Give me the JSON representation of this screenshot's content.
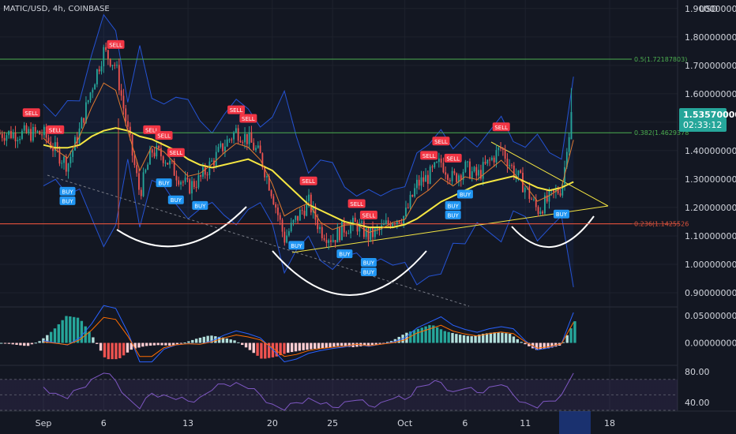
{
  "header": {
    "symbol_line": "MATIC/USD, 4h, COINBASE",
    "currency": "USD"
  },
  "price_axis": {
    "labels": [
      "1.90000000",
      "1.80000000",
      "1.70000000",
      "1.60000000",
      "1.40000000",
      "1.30000000",
      "1.20000000",
      "1.10000000",
      "1.00000000",
      "0.90000000"
    ],
    "current_price": "1.53570000",
    "countdown": "02:33:12"
  },
  "fib_levels": [
    {
      "label": "0.5(1.72187803)",
      "value": 1.72187803,
      "color": "#4caf50"
    },
    {
      "label": "0.382(1.4629378",
      "value": 1.4629378,
      "color": "#4caf50"
    },
    {
      "label": "0.236(1.1425526",
      "value": 1.1425526,
      "color": "#e0533c"
    }
  ],
  "time_axis": {
    "labels": [
      "Sep",
      "6",
      "13",
      "20",
      "25",
      "Oct",
      "6",
      "11",
      "18"
    ]
  },
  "macd_axis": {
    "labels": [
      "0.05000000",
      "0.00000000"
    ]
  },
  "rsi_axis": {
    "labels": [
      "80.00",
      "40.00"
    ]
  },
  "signal_labels": {
    "buy": "BUY",
    "sell": "SELL"
  },
  "colors": {
    "background": "#131722",
    "up_candle": "#26a69a",
    "down_candle": "#ef5350",
    "sma": "#f5e642",
    "bollinger": "#2962ff",
    "rsi": "#7e57c2",
    "buy_badge": "#2196f3",
    "sell_badge": "#f23645",
    "current_price_badge": "#26a69a"
  },
  "chart_data": {
    "type": "candlestick",
    "symbol": "MATIC/USD",
    "timeframe": "4h",
    "exchange": "COINBASE",
    "ylim": [
      0.85,
      1.93
    ],
    "current_price": 1.5357,
    "close_path": [
      {
        "date": "2021-09-01",
        "close": 1.46
      },
      {
        "date": "2021-09-02",
        "close": 1.4
      },
      {
        "date": "2021-09-03",
        "close": 1.35
      },
      {
        "date": "2021-09-04",
        "close": 1.47
      },
      {
        "date": "2021-09-05",
        "close": 1.62
      },
      {
        "date": "2021-09-06",
        "close": 1.75
      },
      {
        "date": "2021-09-07",
        "close": 1.7
      },
      {
        "date": "2021-09-08",
        "close": 1.47
      },
      {
        "date": "2021-09-09",
        "close": 1.25
      },
      {
        "date": "2021-09-10",
        "close": 1.4
      },
      {
        "date": "2021-09-11",
        "close": 1.38
      },
      {
        "date": "2021-09-12",
        "close": 1.32
      },
      {
        "date": "2021-09-13",
        "close": 1.27
      },
      {
        "date": "2021-09-14",
        "close": 1.3
      },
      {
        "date": "2021-09-15",
        "close": 1.36
      },
      {
        "date": "2021-09-16",
        "close": 1.42
      },
      {
        "date": "2021-09-17",
        "close": 1.47
      },
      {
        "date": "2021-09-18",
        "close": 1.44
      },
      {
        "date": "2021-09-19",
        "close": 1.38
      },
      {
        "date": "2021-09-20",
        "close": 1.25
      },
      {
        "date": "2021-09-21",
        "close": 1.09
      },
      {
        "date": "2021-09-22",
        "close": 1.16
      },
      {
        "date": "2021-09-23",
        "close": 1.22
      },
      {
        "date": "2021-09-24",
        "close": 1.12
      },
      {
        "date": "2021-09-25",
        "close": 1.09
      },
      {
        "date": "2021-09-26",
        "close": 1.13
      },
      {
        "date": "2021-09-27",
        "close": 1.14
      },
      {
        "date": "2021-09-28",
        "close": 1.1
      },
      {
        "date": "2021-09-29",
        "close": 1.12
      },
      {
        "date": "2021-09-30",
        "close": 1.16
      },
      {
        "date": "2021-10-01",
        "close": 1.17
      },
      {
        "date": "2021-10-02",
        "close": 1.28
      },
      {
        "date": "2021-10-03",
        "close": 1.31
      },
      {
        "date": "2021-10-04",
        "close": 1.36
      },
      {
        "date": "2021-10-05",
        "close": 1.3
      },
      {
        "date": "2021-10-06",
        "close": 1.34
      },
      {
        "date": "2021-10-07",
        "close": 1.31
      },
      {
        "date": "2021-10-08",
        "close": 1.36
      },
      {
        "date": "2021-10-09",
        "close": 1.41
      },
      {
        "date": "2021-10-10",
        "close": 1.33
      },
      {
        "date": "2021-10-11",
        "close": 1.27
      },
      {
        "date": "2021-10-12",
        "close": 1.19
      },
      {
        "date": "2021-10-13",
        "close": 1.23
      },
      {
        "date": "2021-10-14",
        "close": 1.27
      },
      {
        "date": "2021-10-15",
        "close": 1.5357
      }
    ],
    "indicators": {
      "sma": [
        1.42,
        1.41,
        1.41,
        1.42,
        1.45,
        1.47,
        1.48,
        1.47,
        1.45,
        1.44,
        1.42,
        1.4,
        1.37,
        1.35,
        1.34,
        1.35,
        1.36,
        1.37,
        1.35,
        1.33,
        1.29,
        1.25,
        1.21,
        1.19,
        1.17,
        1.15,
        1.14,
        1.13,
        1.13,
        1.13,
        1.14,
        1.16,
        1.19,
        1.22,
        1.24,
        1.26,
        1.28,
        1.29,
        1.3,
        1.31,
        1.29,
        1.27,
        1.26,
        1.27,
        1.29
      ],
      "macd": [
        0.0,
        -0.003,
        -0.006,
        0.004,
        0.024,
        0.05,
        0.046,
        0.012,
        -0.03,
        -0.03,
        -0.012,
        -0.006,
        -0.004,
        -0.005,
        0.0,
        0.008,
        0.014,
        0.01,
        0.004,
        -0.012,
        -0.03,
        -0.026,
        -0.018,
        -0.014,
        -0.011,
        -0.009,
        -0.005,
        -0.008,
        -0.005,
        -0.002,
        0.004,
        0.018,
        0.026,
        0.034,
        0.022,
        0.016,
        0.012,
        0.017,
        0.02,
        0.017,
        0.0,
        -0.013,
        -0.01,
        -0.004,
        0.04
      ],
      "rsi": [
        60,
        52,
        45,
        58,
        70,
        78,
        68,
        46,
        32,
        52,
        50,
        44,
        42,
        47,
        56,
        64,
        66,
        58,
        50,
        38,
        30,
        40,
        46,
        38,
        34,
        41,
        43,
        36,
        40,
        45,
        44,
        60,
        63,
        66,
        54,
        58,
        53,
        60,
        63,
        50,
        40,
        33,
        42,
        50,
        78
      ]
    },
    "fibonacci": [
      {
        "level": "0.5",
        "price": 1.72187803
      },
      {
        "level": "0.382",
        "price": 1.4629378
      },
      {
        "level": "0.236",
        "price": 1.1425526
      }
    ],
    "signals": [
      {
        "type": "SELL",
        "date": "2021-08-31"
      },
      {
        "type": "SELL",
        "date": "2021-09-02"
      },
      {
        "type": "BUY",
        "date": "2021-09-03"
      },
      {
        "type": "BUY",
        "date": "2021-09-03"
      },
      {
        "type": "SELL",
        "date": "2021-09-07"
      },
      {
        "type": "SELL",
        "date": "2021-09-10"
      },
      {
        "type": "BUY",
        "date": "2021-09-11"
      },
      {
        "type": "BUY",
        "date": "2021-09-12"
      },
      {
        "type": "SELL",
        "date": "2021-09-11"
      },
      {
        "type": "SELL",
        "date": "2021-09-12"
      },
      {
        "type": "BUY",
        "date": "2021-09-14"
      },
      {
        "type": "SELL",
        "date": "2021-09-17"
      },
      {
        "type": "SELL",
        "date": "2021-09-18"
      },
      {
        "type": "BUY",
        "date": "2021-09-22"
      },
      {
        "type": "SELL",
        "date": "2021-09-23"
      },
      {
        "type": "BUY",
        "date": "2021-09-26"
      },
      {
        "type": "SELL",
        "date": "2021-09-27"
      },
      {
        "type": "SELL",
        "date": "2021-09-28"
      },
      {
        "type": "BUY",
        "date": "2021-09-28"
      },
      {
        "type": "BUY",
        "date": "2021-09-28"
      },
      {
        "type": "SELL",
        "date": "2021-10-03"
      },
      {
        "type": "SELL",
        "date": "2021-10-04"
      },
      {
        "type": "SELL",
        "date": "2021-10-05"
      },
      {
        "type": "BUY",
        "date": "2021-10-05"
      },
      {
        "type": "BUY",
        "date": "2021-10-05"
      },
      {
        "type": "BUY",
        "date": "2021-10-06"
      },
      {
        "type": "SELL",
        "date": "2021-10-09"
      },
      {
        "type": "BUY",
        "date": "2021-10-14"
      }
    ]
  }
}
